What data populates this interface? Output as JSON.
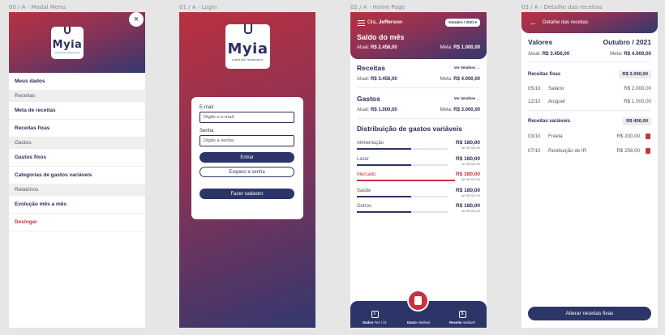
{
  "labels": {
    "f0": "00 / A - Modal Menu",
    "f1": "01 / A - Login",
    "f2": "02 / A - Home Page",
    "f3": "03 / A - Detalhe das receitas"
  },
  "brand": {
    "name": "Myia",
    "tagline": "controle financeiro"
  },
  "menu": {
    "close": "×",
    "items": [
      "Meus dados",
      "Receitas",
      "Meta de receitas",
      "Receitas fixas",
      "Gastos",
      "Gastos fixos",
      "Categorias de gastos variáveis",
      "Relatórios",
      "Evolução mês a mês",
      "Deslogar"
    ]
  },
  "login": {
    "email_label": "E-mail",
    "email_placeholder": "Digite o e-mail",
    "password_label": "Senha",
    "password_placeholder": "Digite a senha",
    "enter": "Entrar",
    "forgot": "Esqueci a senha",
    "register": "Fazer cadastro"
  },
  "home": {
    "greeting_prefix": "Olá,",
    "greeting_name": "Jefferson",
    "month": "Outubro / 2021 ▾",
    "balance_title": "Saldo do mês",
    "actual_label": "Atual:",
    "goal_label": "Meta:",
    "balance_actual": "R$ 2.456,00",
    "balance_goal": "R$ 1.000,00",
    "income_title": "Receitas",
    "income_link": "Ver detalhes →",
    "income_actual": "R$ 3.456,00",
    "income_goal": "R$ 4.000,00",
    "expense_title": "Gastos",
    "expense_link": "Ver detalhes →",
    "expense_actual": "R$ 1.000,00",
    "expense_goal": "R$ 3.000,00",
    "dist_title": "Distribuição de gastos variáveis",
    "categories": [
      {
        "name": "Alimentação",
        "value": "R$ 180,00",
        "limit": "de R$ 300,00",
        "fraction": 0.6
      },
      {
        "name": "Lazer",
        "value": "R$ 180,00",
        "limit": "de R$ 300,00",
        "fraction": 0.6
      },
      {
        "name": "Mercado",
        "value": "R$ 380,00",
        "limit": "de R$ 300,00",
        "fraction": 1.0
      },
      {
        "name": "Saúde",
        "value": "R$ 180,00",
        "limit": "de R$ 300,00",
        "fraction": 0.6
      },
      {
        "name": "Outros",
        "value": "R$ 180,00",
        "limit": "de R$ 300,00",
        "fraction": 0.6
      }
    ],
    "tabs": {
      "left_bold": "Dados",
      "left_rest": " Fev / 21",
      "mid_bold": "Gasto",
      "mid_rest": " Variável",
      "right_bold": "Receita",
      "right_rest": " Variável"
    }
  },
  "detail": {
    "title": "Detalhe das receitas",
    "values_label": "Valores",
    "month": "Outubro / 2021",
    "actual": "R$ 3.456,00",
    "goal": "R$ 4.000,00",
    "fixed_title": "Receitas fixas",
    "fixed_total": "R$ 3.000,00",
    "fixed": [
      {
        "date": "05/10",
        "name": "Salário",
        "value": "R$ 2.000,00"
      },
      {
        "date": "12/10",
        "name": "Aluguel",
        "value": "R$ 1.000,00"
      }
    ],
    "variable_title": "Receitas variáveis",
    "variable_total": "R$ 456,00",
    "variable": [
      {
        "date": "03/10",
        "name": "Freela",
        "value": "R$ 200,00"
      },
      {
        "date": "07/10",
        "name": "Restituição de IR",
        "value": "R$ 256,00"
      }
    ],
    "button": "Alterar receitas fixas"
  }
}
